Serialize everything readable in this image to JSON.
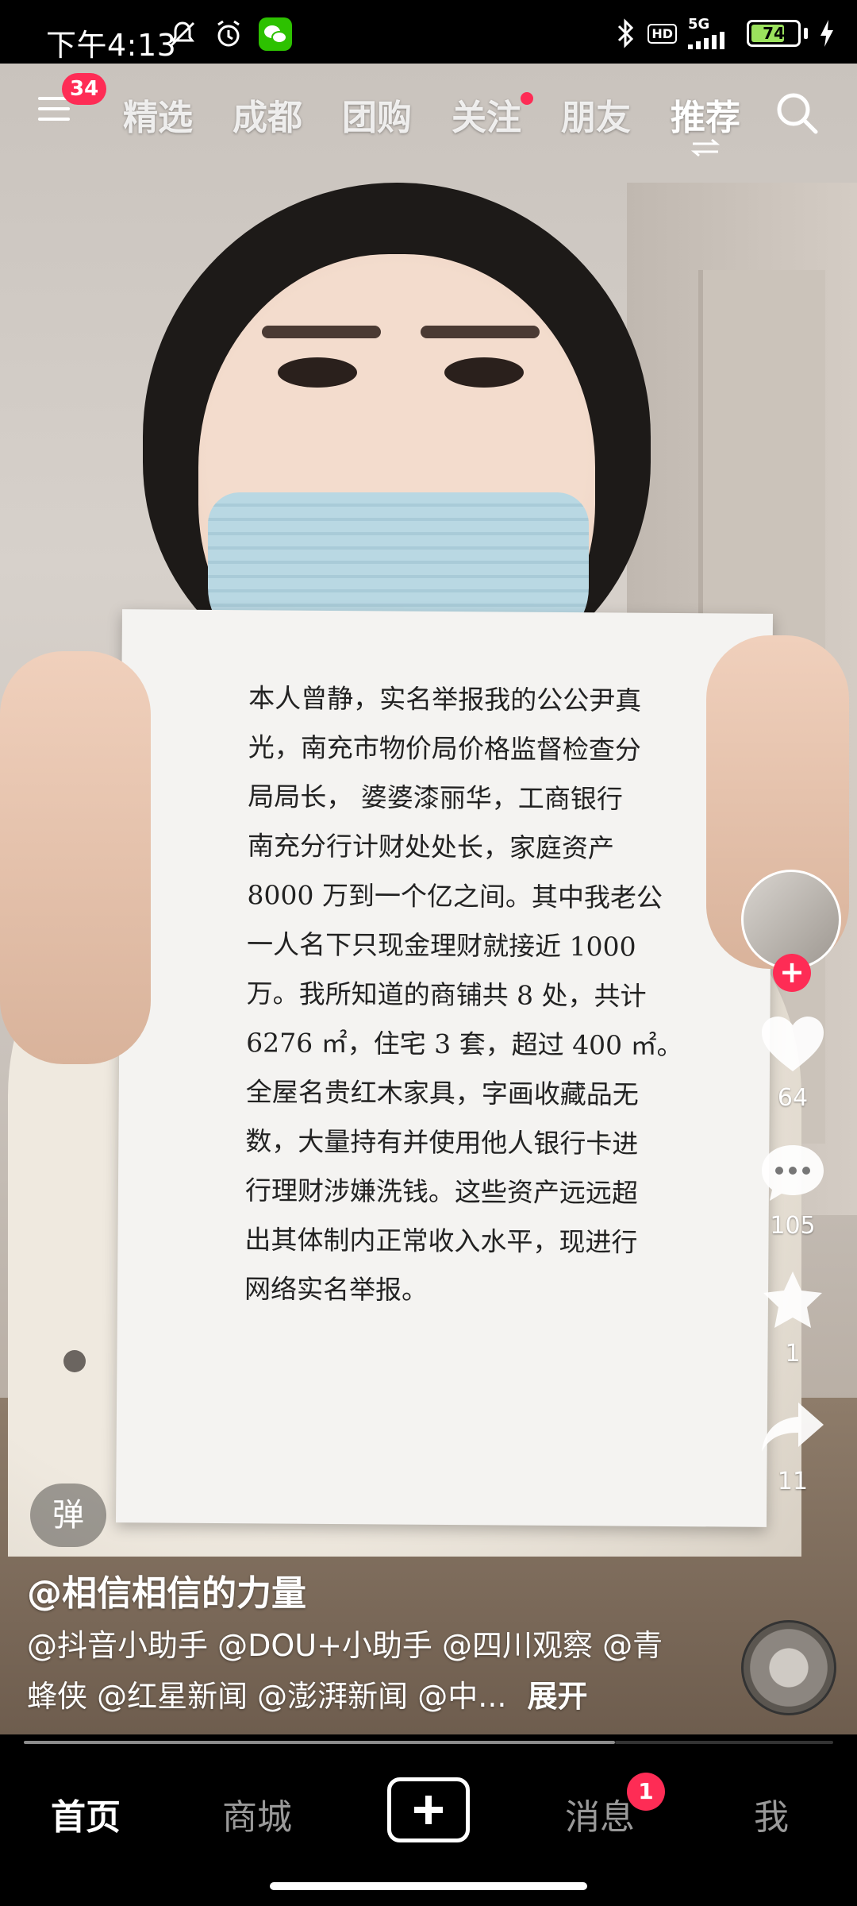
{
  "status_bar": {
    "time": "下午4:13",
    "network": "5G",
    "hd": "HD",
    "battery_level": "74",
    "battery_fraction": 0.74,
    "icons": [
      "mute-icon",
      "alarm-icon",
      "wechat-icon",
      "bluetooth-icon",
      "signal-icon",
      "charging-icon"
    ]
  },
  "top_nav": {
    "menu_badge": "34",
    "tabs": [
      {
        "label": "精选"
      },
      {
        "label": "成都"
      },
      {
        "label": "团购"
      },
      {
        "label": "关注"
      },
      {
        "label": "朋友"
      },
      {
        "label": "推荐"
      }
    ],
    "active_tab": "推荐"
  },
  "video": {
    "paper_text": "本人曾静，实名举报我的公公尹真\n光，南充市物价局价格监督检查分\n局局长， 婆婆漆丽华，工商银行\n南充分行计财处处长，家庭资产\n8000 万到一个亿之间。其中我老公\n一人名下只现金理财就接近 1000\n万。我所知道的商铺共 8 处，共计\n6276 ㎡，住宅 3 套，超过 400 ㎡。\n全屋名贵红木家具，字画收藏品无\n数，大量持有并使用他人银行卡进\n行理财涉嫌洗钱。这些资产远远超\n出其体制内正常收入水平，现进行\n网络实名举报。"
  },
  "right_rail": {
    "follow_plus": "+",
    "likes": "64",
    "comments": "105",
    "favorites": "1",
    "shares": "11"
  },
  "caption": {
    "danmaku": "弹",
    "author": "@相信相信的力量",
    "description": "@抖音小助手 @DOU+小助手 @四川观察 @青蜂侠 @红星新闻 @澎湃新闻 @中...",
    "expand": "展开",
    "progress_fraction": 0.73
  },
  "bottom_nav": {
    "home": "首页",
    "mall": "商城",
    "messages": "消息",
    "messages_badge": "1",
    "me": "我"
  },
  "colors": {
    "accent": "#fe2c55",
    "battery": "#9be15d"
  }
}
